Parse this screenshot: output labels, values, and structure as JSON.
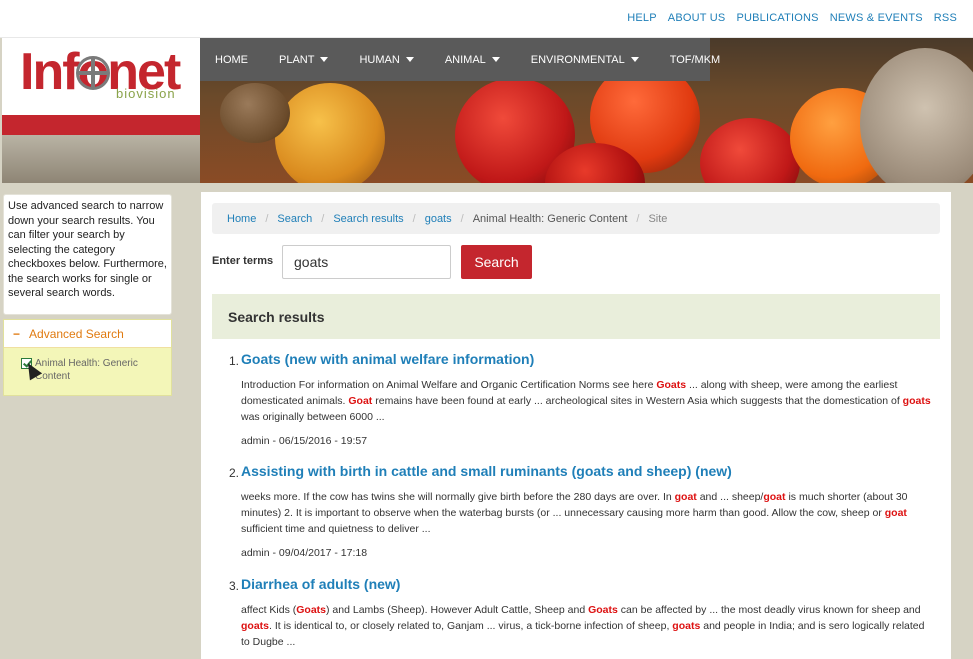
{
  "toplinks": [
    "HELP",
    "ABOUT US",
    "PUBLICATIONS",
    "NEWS & EVENTS",
    "RSS"
  ],
  "logo": {
    "name": "Infonet",
    "sub": "biovision"
  },
  "nav": [
    {
      "label": "HOME",
      "dropdown": false
    },
    {
      "label": "PLANT",
      "dropdown": true
    },
    {
      "label": "HUMAN",
      "dropdown": true
    },
    {
      "label": "ANIMAL",
      "dropdown": true
    },
    {
      "label": "ENVIRONMENTAL",
      "dropdown": true
    },
    {
      "label": "TOF/MKM",
      "dropdown": false
    }
  ],
  "sidebar": {
    "info": "Use advanced search to narrow down your search results. You can filter your search by selecting the category checkboxes below. Furthermore, the search works for single or several search words.",
    "advanced_title": "Advanced Search",
    "advanced_toggle": "−",
    "filter_label": "Animal Health: Generic Content"
  },
  "breadcrumb": [
    "Home",
    "Search",
    "Search results",
    "goats",
    "Animal Health: Generic Content",
    "Site"
  ],
  "search": {
    "label": "Enter terms",
    "value": "goats",
    "button": "Search"
  },
  "results_heading": "Search results",
  "results": [
    {
      "num": "1.",
      "title": "Goats (new with animal welfare information)",
      "snippet": [
        {
          "t": "Introduction For information on Animal Welfare and Organic  Certification  Norms see  here  "
        },
        {
          "t": "Goats",
          "hl": true
        },
        {
          "t": " ... along with sheep, were among the earliest domesticated animals. "
        },
        {
          "t": "Goat",
          "hl": true
        },
        {
          "t": " remains have been found at early ... archeological sites in Western Asia which suggests that the domestication of "
        },
        {
          "t": "goats",
          "hl": true
        },
        {
          "t": " was originally between 6000 ..."
        }
      ],
      "meta": "admin - 06/15/2016 - 19:57"
    },
    {
      "num": "2.",
      "title": "Assisting with birth in cattle and small ruminants (goats and sheep) (new)",
      "snippet": [
        {
          "t": "weeks more. If the cow has twins she will normally give birth before the 280 days are over. In "
        },
        {
          "t": "goat",
          "hl": true
        },
        {
          "t": " and ... sheep/"
        },
        {
          "t": "goat",
          "hl": true
        },
        {
          "t": " is much shorter (about 30 minutes) 2. It is important to observe when the waterbag bursts (or ... unnecessary causing more harm than good. Allow the cow, sheep or "
        },
        {
          "t": "goat",
          "hl": true
        },
        {
          "t": " sufficient time and quietness to deliver ..."
        }
      ],
      "meta": "admin - 09/04/2017 - 17:18"
    },
    {
      "num": "3.",
      "title": "Diarrhea of adults (new)",
      "snippet": [
        {
          "t": "affect Kids ("
        },
        {
          "t": "Goats",
          "hl": true
        },
        {
          "t": ") and Lambs (Sheep). However Adult Cattle, Sheep and "
        },
        {
          "t": "Goats",
          "hl": true
        },
        {
          "t": " can be affected by ... the most deadly virus known for sheep and "
        },
        {
          "t": "goats",
          "hl": true
        },
        {
          "t": ". It is identical to, or closely related to, Ganjam ... virus, a tick-borne infection of sheep, "
        },
        {
          "t": "goats",
          "hl": true
        },
        {
          "t": " and people in India; and is sero logically related to Dugbe ..."
        }
      ],
      "meta": ""
    }
  ],
  "colors": {
    "brand_red": "#c4262e",
    "link_blue": "#1f7fb8",
    "highlight_red": "#dd1111",
    "nav_bg": "#5a5a5a",
    "results_head_bg": "#e9eedb",
    "sidebar_adv_bg": "#f3f6b8",
    "page_bg": "#d6d3c4"
  }
}
